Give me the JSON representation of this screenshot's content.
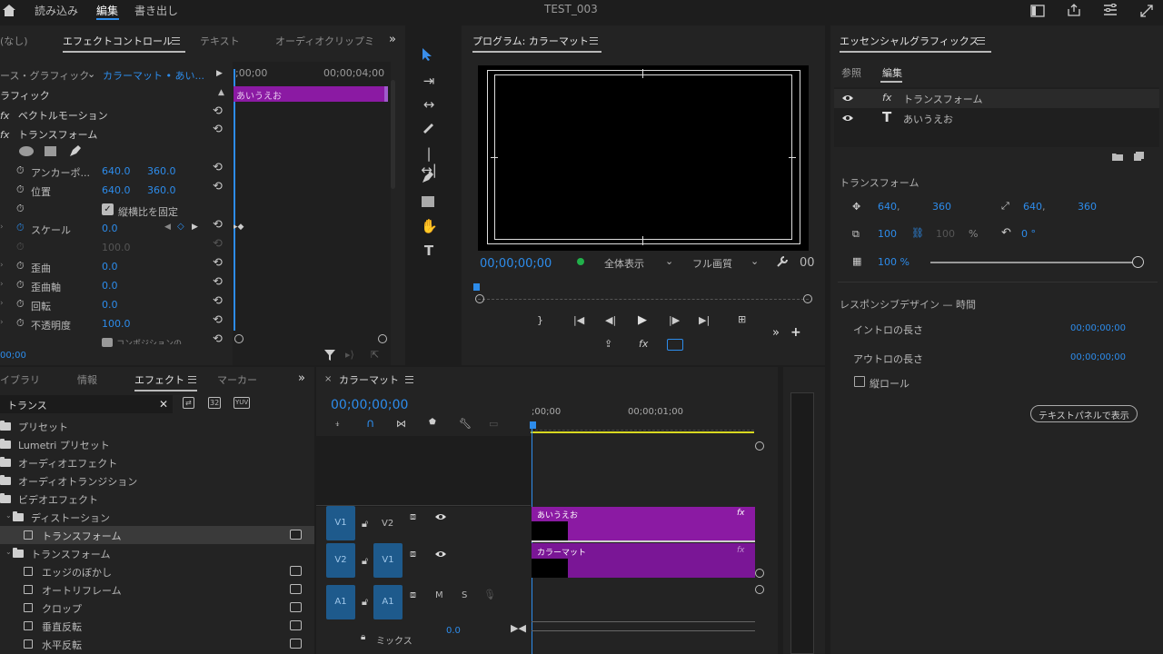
{
  "app": {
    "title": "TEST_003",
    "workspace_tabs": [
      "読み込み",
      "編集",
      "書き出し"
    ],
    "active_workspace": "編集"
  },
  "effect_controls": {
    "tabs": [
      "(なし)",
      "エフェクトコントロール",
      "テキスト",
      "オーディオクリップミ"
    ],
    "source_label": "ース・グラフィック",
    "clip_selector": "カラーマット • あい...",
    "timecode_start": ";00;00",
    "timecode_end": "00;00;04;00",
    "clip_bar_label": "あいうえお",
    "section_title": "ラフィック",
    "vector_motion": "ベクトルモーション",
    "transform": "トランスフォーム",
    "fx_label": "fx",
    "props": {
      "anchor": {
        "label": "アンカーポ...",
        "x": "640.0",
        "y": "360.0"
      },
      "position": {
        "label": "位置",
        "x": "640.0",
        "y": "360.0"
      },
      "uniform_scale": "縦横比を固定",
      "scale": {
        "label": "スケール",
        "value": "0.0"
      },
      "scale_width": "100.0",
      "skew": {
        "label": "歪曲",
        "value": "0.0"
      },
      "skew_axis": {
        "label": "歪曲軸",
        "value": "0.0"
      },
      "rotation": {
        "label": "回転",
        "value": "0.0"
      },
      "opacity": {
        "label": "不透明度",
        "value": "100.0"
      },
      "composite": "コンポジションの..."
    },
    "bottom_timecode": "00;00"
  },
  "program": {
    "title": "プログラム: カラーマット",
    "timecode": "00;00;00;00",
    "zoom": "全体表示",
    "quality": "フル画質",
    "end_timecode": "00"
  },
  "essential_graphics": {
    "title": "エッセンシャルグラフィックス",
    "tabs": [
      "参照",
      "編集"
    ],
    "layers": [
      "トランスフォーム",
      "あいうえお"
    ],
    "transform_title": "トランスフォーム",
    "pos_x": "640",
    "pos_y": "360",
    "anchor_x": "640",
    "anchor_y": "360",
    "scale": "100",
    "scale_h": "100",
    "scale_unit": "%",
    "rotation": "0 °",
    "opacity": "100 %",
    "opacity_fraction": 1.0,
    "responsive_title": "レスポンシブデザイン — 時間",
    "intro_label": "イントロの長さ",
    "intro_value": "00;00;00;00",
    "outro_label": "アウトロの長さ",
    "outro_value": "00;00;00;00",
    "roll_label": "縦ロール",
    "text_panel_button": "テキストパネルで表示"
  },
  "effects_panel": {
    "tabs": [
      "イブラリ",
      "情報",
      "エフェクト",
      "マーカー"
    ],
    "search_value": "トランス",
    "items": [
      {
        "label": "プリセット",
        "indent": 0,
        "kind": "folder"
      },
      {
        "label": "Lumetri プリセット",
        "indent": 0,
        "kind": "folder"
      },
      {
        "label": "オーディオエフェクト",
        "indent": 0,
        "kind": "folder"
      },
      {
        "label": "オーディオトランジション",
        "indent": 0,
        "kind": "folder"
      },
      {
        "label": "ビデオエフェクト",
        "indent": 0,
        "kind": "folder"
      },
      {
        "label": "ディストーション",
        "indent": 1,
        "kind": "folder"
      },
      {
        "label": "トランスフォーム",
        "indent": 2,
        "kind": "effect",
        "selected": true
      },
      {
        "label": "トランスフォーム",
        "indent": 1,
        "kind": "folder"
      },
      {
        "label": "エッジのぼかし",
        "indent": 2,
        "kind": "effect"
      },
      {
        "label": "オートリフレーム",
        "indent": 2,
        "kind": "effect"
      },
      {
        "label": "クロップ",
        "indent": 2,
        "kind": "effect"
      },
      {
        "label": "垂直反転",
        "indent": 2,
        "kind": "effect"
      },
      {
        "label": "水平反転",
        "indent": 2,
        "kind": "effect"
      }
    ]
  },
  "timeline": {
    "sequence_name": "カラーマット",
    "timecode": "00;00;00;00",
    "ruler": [
      ";00;00",
      "00;00;01;00"
    ],
    "tracks": {
      "v2": {
        "src": "V1",
        "label": "V2"
      },
      "v1": {
        "src": "V2",
        "label": "V1"
      },
      "a1": {
        "src": "A1",
        "label": "A1",
        "m": "M",
        "s": "S"
      }
    },
    "clip_top": "あいうえお",
    "clip_bottom": "カラーマット",
    "mix_label": "ミックス",
    "mix_value": "0.0"
  }
}
